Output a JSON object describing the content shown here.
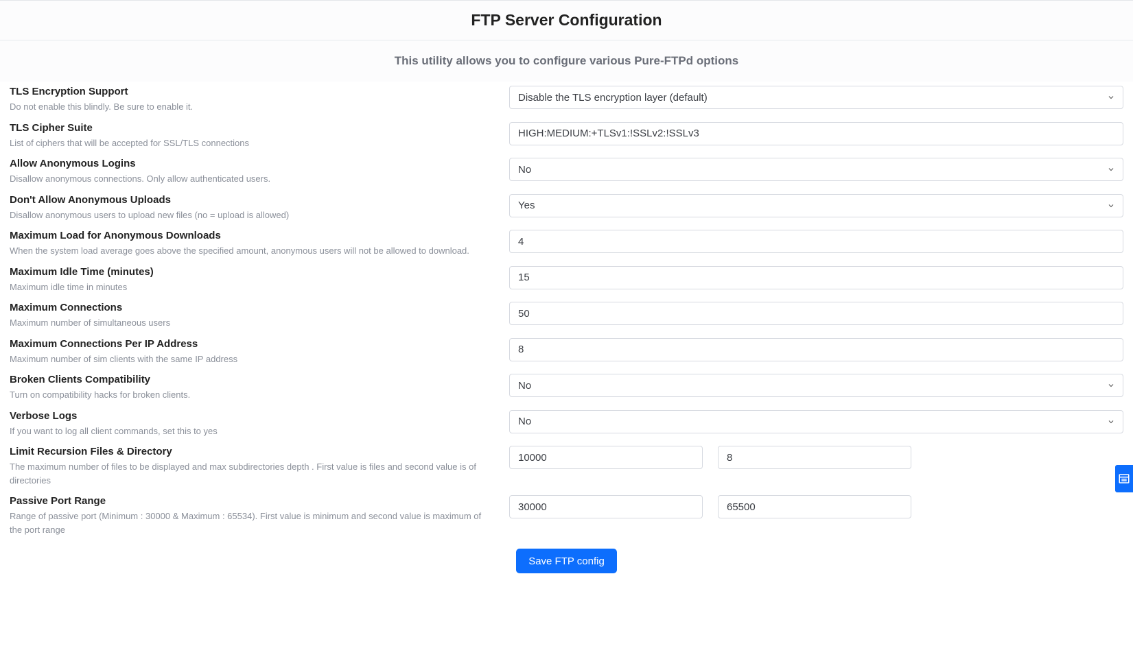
{
  "header": {
    "title": "FTP Server Configuration",
    "subtitle": "This utility allows you to configure various Pure-FTPd options"
  },
  "rows": {
    "tls_support": {
      "label": "TLS Encryption Support",
      "desc": "Do not enable this blindly. Be sure to enable it.",
      "value": "Disable the TLS encryption layer (default)"
    },
    "tls_cipher": {
      "label": "TLS Cipher Suite",
      "desc": "List of ciphers that will be accepted for SSL/TLS connections",
      "value": "HIGH:MEDIUM:+TLSv1:!SSLv2:!SSLv3"
    },
    "anon_login": {
      "label": "Allow Anonymous Logins",
      "desc": "Disallow anonymous connections. Only allow authenticated users.",
      "value": "No"
    },
    "anon_upload": {
      "label": "Don't Allow Anonymous Uploads",
      "desc": "Disallow anonymous users to upload new files (no = upload is allowed)",
      "value": "Yes"
    },
    "anon_load": {
      "label": "Maximum Load for Anonymous Downloads",
      "desc": "When the system load average goes above the specified amount, anonymous users will not be allowed to download.",
      "value": "4"
    },
    "idle": {
      "label": "Maximum Idle Time (minutes)",
      "desc": "Maximum idle time in minutes",
      "value": "15"
    },
    "max_conn": {
      "label": "Maximum Connections",
      "desc": "Maximum number of simultaneous users",
      "value": "50"
    },
    "max_conn_ip": {
      "label": "Maximum Connections Per IP Address",
      "desc": "Maximum number of sim clients with the same IP address",
      "value": "8"
    },
    "broken": {
      "label": "Broken Clients Compatibility",
      "desc": "Turn on compatibility hacks for broken clients.",
      "value": "No"
    },
    "verbose": {
      "label": "Verbose Logs",
      "desc": "If you want to log all client commands, set this to yes",
      "value": "No"
    },
    "recursion": {
      "label": "Limit Recursion Files & Directory",
      "desc": "The maximum number of files to be displayed and max subdirectories depth . First value is files and second value is of directories",
      "files": "10000",
      "dirs": "8"
    },
    "passive": {
      "label": "Passive Port Range",
      "desc": "Range of passive port (Minimum : 30000 & Maximum : 65534). First value is minimum and second value is maximum of the port range",
      "min": "30000",
      "max": "65500"
    }
  },
  "buttons": {
    "save": "Save FTP config"
  }
}
